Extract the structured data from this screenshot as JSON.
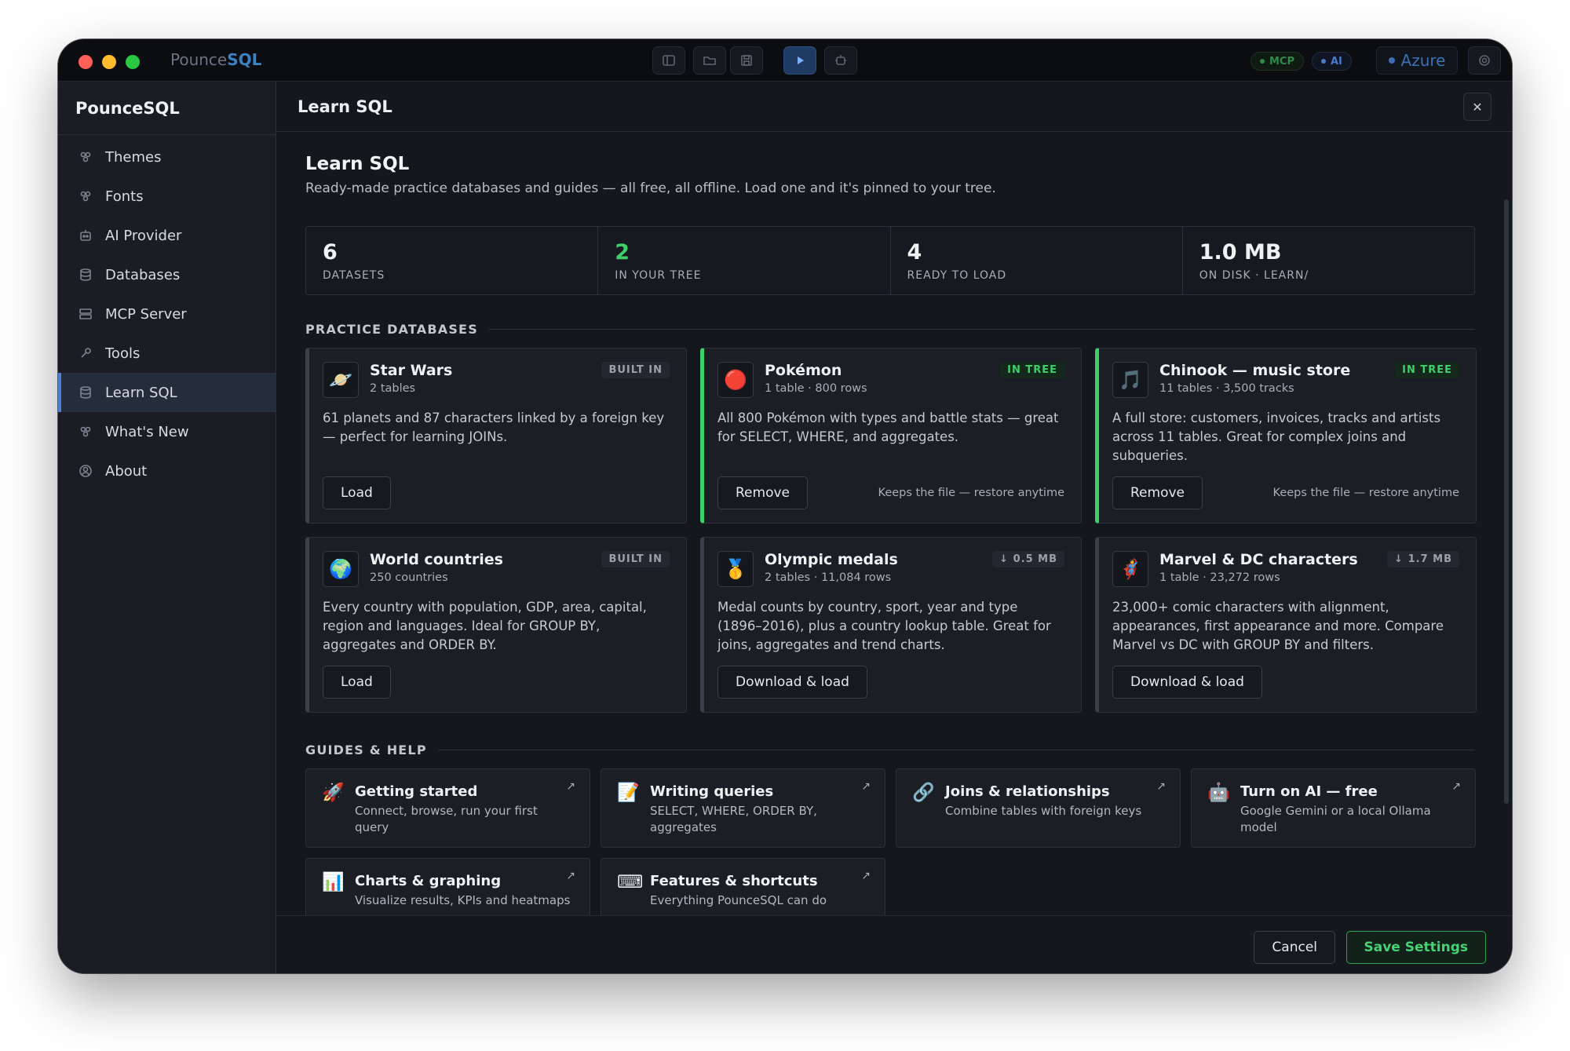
{
  "app": {
    "name_prefix": "Pounce",
    "name_suffix": "SQL"
  },
  "titlebar": {
    "mcp_label": "MCP",
    "ai_label": "AI",
    "azure_label": "Azure"
  },
  "sidebar": {
    "title": "PounceSQL",
    "items": [
      {
        "label": "Themes",
        "icon": "palette-icon"
      },
      {
        "label": "Fonts",
        "icon": "palette-icon"
      },
      {
        "label": "AI Provider",
        "icon": "robot-icon"
      },
      {
        "label": "Databases",
        "icon": "database-icon"
      },
      {
        "label": "MCP Server",
        "icon": "server-icon"
      },
      {
        "label": "Tools",
        "icon": "wrench-icon"
      },
      {
        "label": "Learn SQL",
        "icon": "database-icon",
        "active": true
      },
      {
        "label": "What's New",
        "icon": "palette-icon"
      },
      {
        "label": "About",
        "icon": "user-circle-icon"
      }
    ]
  },
  "main": {
    "header_title": "Learn SQL",
    "close_label": "✕",
    "title": "Learn SQL",
    "subtitle": "Ready-made practice databases and guides — all free, all offline. Load one and it's pinned to your tree."
  },
  "stats": [
    {
      "value": "6",
      "label": "DATASETS"
    },
    {
      "value": "2",
      "label": "IN YOUR TREE",
      "accent": "#3ecf6b"
    },
    {
      "value": "4",
      "label": "READY TO LOAD"
    },
    {
      "value": "1.0 MB",
      "label": "ON DISK · LEARN/"
    }
  ],
  "practice": {
    "heading": "PRACTICE DATABASES",
    "cards": [
      {
        "name": "Star Wars",
        "meta": "2 tables",
        "badge": "BUILT IN",
        "icon": "🪐",
        "desc": "61 planets and 87 characters linked by a foreign key — perfect for learning JOINs.",
        "action": "Load",
        "note": ""
      },
      {
        "name": "Pokémon",
        "meta": "1 table · 800 rows",
        "badge": "IN TREE",
        "icon": "🔴",
        "desc": "All 800 Pokémon with types and battle stats — great for SELECT, WHERE, and aggregates.",
        "action": "Remove",
        "note": "Keeps the file — restore anytime"
      },
      {
        "name": "Chinook — music store",
        "meta": "11 tables · 3,500 tracks",
        "badge": "IN TREE",
        "icon": "🎵",
        "desc": "A full store: customers, invoices, tracks and artists across 11 tables. Great for complex joins and subqueries.",
        "action": "Remove",
        "note": "Keeps the file — restore anytime"
      },
      {
        "name": "World countries",
        "meta": "250 countries",
        "badge": "BUILT IN",
        "icon": "🌍",
        "desc": "Every country with population, GDP, area, capital, region and languages. Ideal for GROUP BY, aggregates and ORDER BY.",
        "action": "Load",
        "note": ""
      },
      {
        "name": "Olympic medals",
        "meta": "2 tables · 11,084 rows",
        "badge": "↓ 0.5 MB",
        "icon": "🥇",
        "desc": "Medal counts by country, sport, year and type (1896–2016), plus a country lookup table. Great for joins, aggregates and trend charts.",
        "action": "Download & load",
        "note": ""
      },
      {
        "name": "Marvel & DC characters",
        "meta": "1 table · 23,272 rows",
        "badge": "↓ 1.7 MB",
        "icon": "🦸",
        "desc": "23,000+ comic characters with alignment, appearances, first appearance and more. Compare Marvel vs DC with GROUP BY and filters.",
        "action": "Download & load",
        "note": ""
      }
    ]
  },
  "guides": {
    "heading": "GUIDES & HELP",
    "arrow": "↗",
    "items": [
      {
        "title": "Getting started",
        "desc": "Connect, browse, run your first query",
        "icon": "🚀"
      },
      {
        "title": "Writing queries",
        "desc": "SELECT, WHERE, ORDER BY, aggregates",
        "icon": "📝"
      },
      {
        "title": "Joins & relationships",
        "desc": "Combine tables with foreign keys",
        "icon": "🔗"
      },
      {
        "title": "Turn on AI — free",
        "desc": "Google Gemini or a local Ollama model",
        "icon": "🤖"
      },
      {
        "title": "Charts & graphing",
        "desc": "Visualize results, KPIs and heatmaps",
        "icon": "📊"
      },
      {
        "title": "Features & shortcuts",
        "desc": "Everything PounceSQL can do",
        "icon": "⌨"
      }
    ]
  },
  "footer": {
    "cancel_label": "Cancel",
    "save_label": "Save Settings"
  }
}
